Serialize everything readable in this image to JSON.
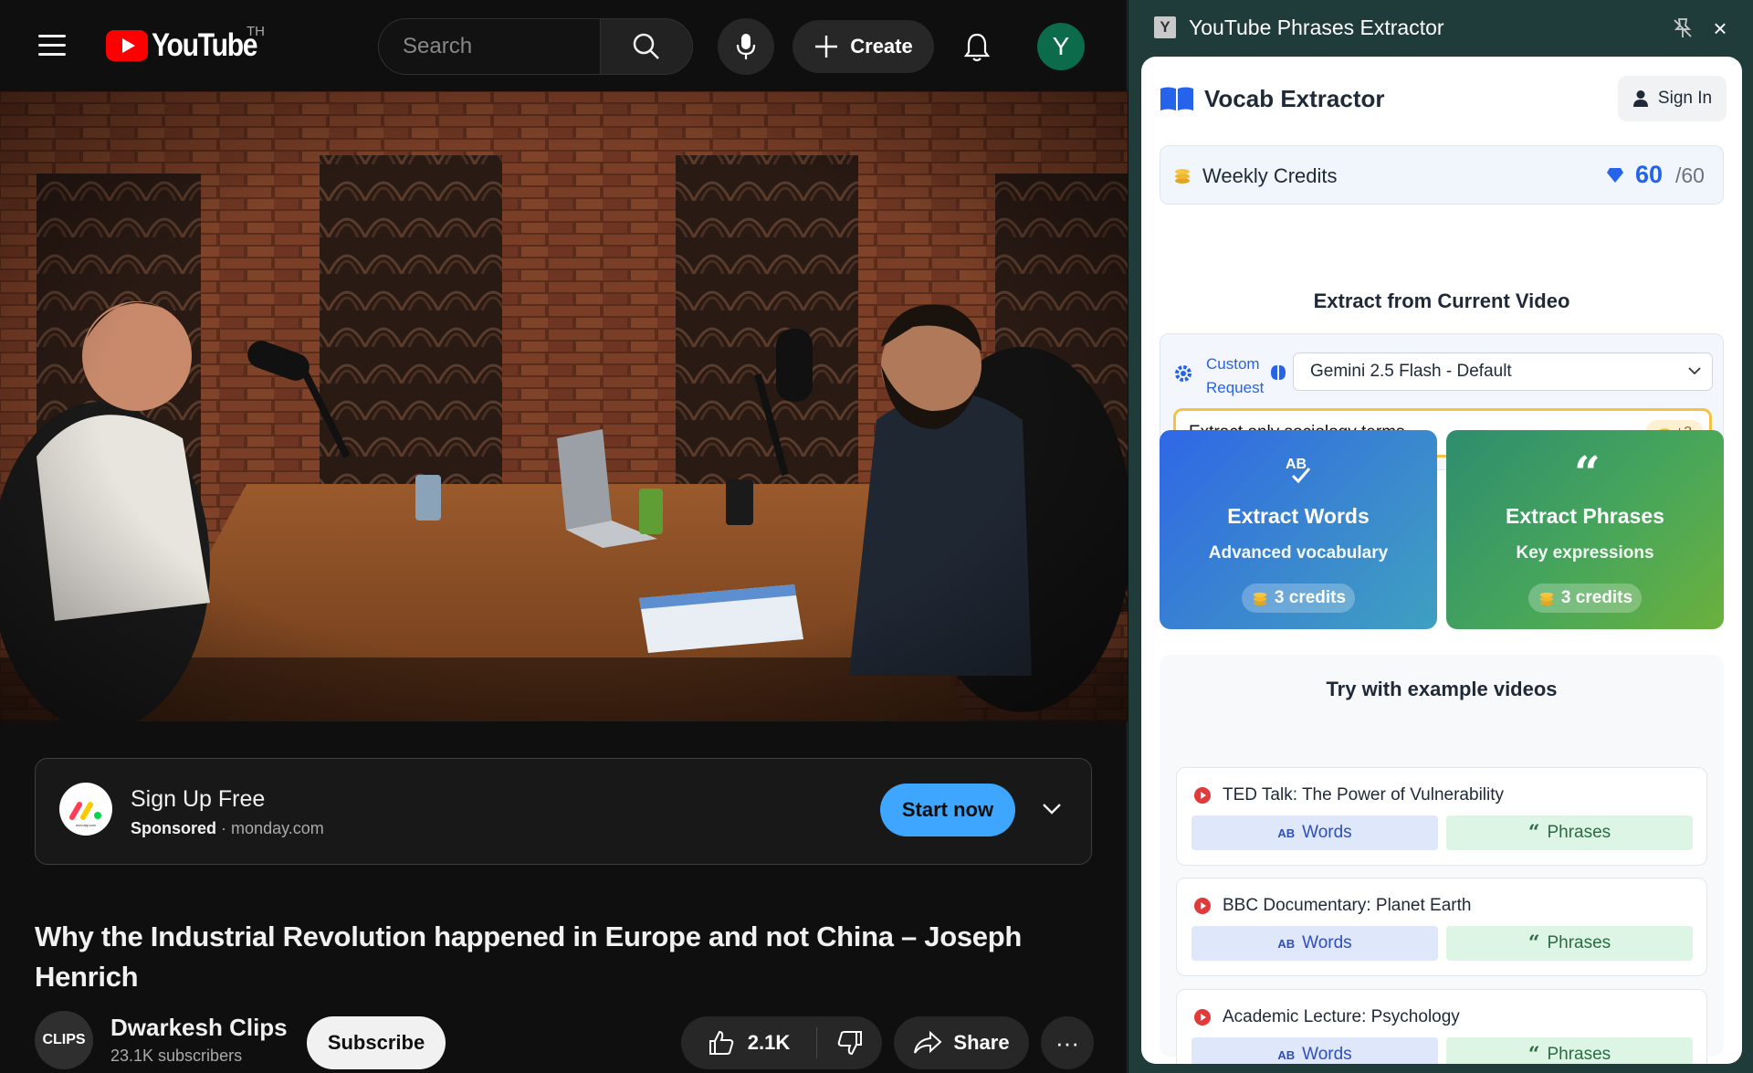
{
  "youtube": {
    "logo_text": "YouTube",
    "country_code": "TH",
    "search_placeholder": "Search",
    "create_label": "Create",
    "avatar_letter": "Y",
    "ad": {
      "title": "Sign Up Free",
      "sponsored": "Sponsored",
      "separator": "·",
      "domain": "monday.com",
      "cta": "Start now",
      "logo_caption": "monday.com"
    },
    "video_title": "Why the Industrial Revolution happened in Europe and not China – Joseph Henrich",
    "channel": {
      "avatar_text": "CLIPS",
      "name": "Dwarkesh Clips",
      "subscribers": "23.1K subscribers",
      "subscribe_label": "Subscribe"
    },
    "likes": "2.1K",
    "share_label": "Share",
    "more_label": "···"
  },
  "extension": {
    "window_icon_letter": "Y",
    "window_title": "YouTube Phrases Extractor",
    "close_glyph": "×",
    "header_title": "Vocab Extractor",
    "sign_in_label": "Sign In",
    "credits": {
      "label": "Weekly Credits",
      "value": "60",
      "max": "/60"
    },
    "extract_heading": "Extract from Current Video",
    "custom_request_line1": "Custom",
    "custom_request_line2": "Request",
    "model_selected": "Gemini 2.5 Flash - Default",
    "request_input_value": "Extract only sociology terms",
    "request_cost": "+3",
    "extract_words": {
      "icon_text": "AB",
      "title": "Extract Words",
      "subtitle": "Advanced vocabulary",
      "credits": "3 credits"
    },
    "extract_phrases": {
      "icon_text": "“",
      "title": "Extract Phrases",
      "subtitle": "Key expressions",
      "credits": "3 credits"
    },
    "examples_heading": "Try with example videos",
    "examples": [
      {
        "name": "TED Talk: The Power of Vulnerability",
        "words": "Words",
        "phrases": "Phrases"
      },
      {
        "name": "BBC Documentary: Planet Earth",
        "words": "Words",
        "phrases": "Phrases"
      },
      {
        "name": "Academic Lecture: Psychology",
        "words": "Words",
        "phrases": "Phrases"
      }
    ],
    "ab_mini": "AB",
    "quote_mini": "“"
  },
  "colors": {
    "accent_blue": "#2563eb",
    "youtube_red": "#ff0000",
    "start_now_blue": "#3ea6ff",
    "input_highlight": "#f5c242",
    "words_gradient_start": "#2f67e6",
    "phrases_gradient_end": "#6bb13d",
    "extension_frame": "#1f3b3a"
  }
}
